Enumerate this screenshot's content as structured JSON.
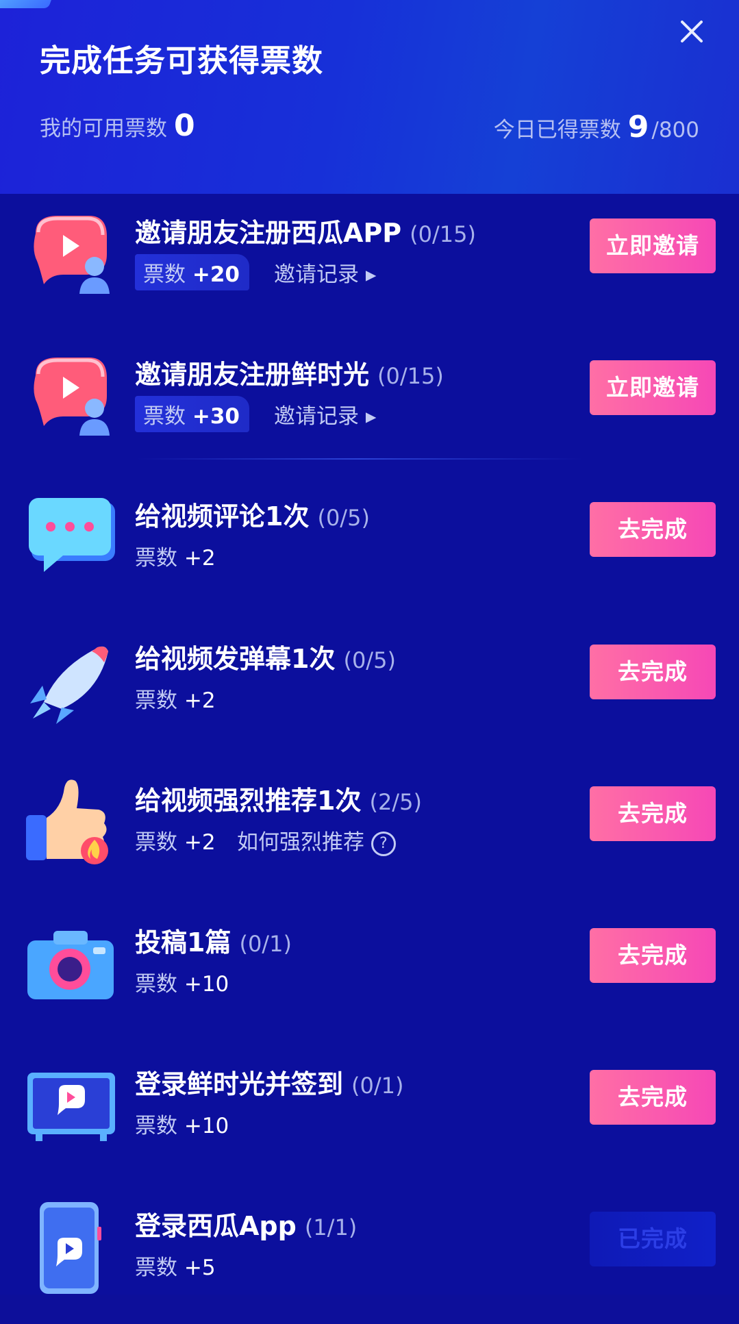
{
  "header": {
    "title": "完成任务可获得票数",
    "my_votes_label": "我的可用票数",
    "my_votes_value": "0",
    "today_label": "今日已得票数",
    "today_value": "9",
    "today_total": "/800"
  },
  "colors": {
    "background": "#0c0f9d",
    "header_bg": "#1730d8",
    "button_pink": "#f648b6",
    "text_muted": "#c2cbf4"
  },
  "tasks": [
    {
      "icon": "invite-friend-icon",
      "title": "邀请朋友注册西瓜APP",
      "progress": "(0/15)",
      "reward_label": "票数",
      "reward_value": "+20",
      "link": "邀请记录",
      "button": "立即邀请"
    },
    {
      "icon": "invite-friend-icon",
      "title": "邀请朋友注册鲜时光",
      "progress": "(0/15)",
      "reward_label": "票数",
      "reward_value": "+30",
      "link": "邀请记录",
      "button": "立即邀请"
    },
    {
      "icon": "comment-bubble-icon",
      "title": "给视频评论1次",
      "progress": "(0/5)",
      "reward_label": "票数",
      "reward_value": "+2",
      "button": "去完成"
    },
    {
      "icon": "rocket-icon",
      "title": "给视频发弹幕1次",
      "progress": "(0/5)",
      "reward_label": "票数",
      "reward_value": "+2",
      "button": "去完成"
    },
    {
      "icon": "thumbs-up-fire-icon",
      "title": "给视频强烈推荐1次",
      "progress": "(2/5)",
      "reward_label": "票数",
      "reward_value": "+2",
      "link": "如何强烈推荐",
      "button": "去完成"
    },
    {
      "icon": "camera-icon",
      "title": "投稿1篇",
      "progress": "(0/1)",
      "reward_label": "票数",
      "reward_value": "+10",
      "button": "去完成"
    },
    {
      "icon": "tv-icon",
      "title": "登录鲜时光并签到",
      "progress": "(0/1)",
      "reward_label": "票数",
      "reward_value": "+10",
      "button": "去完成"
    },
    {
      "icon": "phone-icon",
      "title": "登录西瓜App",
      "progress": "(1/1)",
      "reward_label": "票数",
      "reward_value": "+5",
      "button": "已完成"
    }
  ]
}
